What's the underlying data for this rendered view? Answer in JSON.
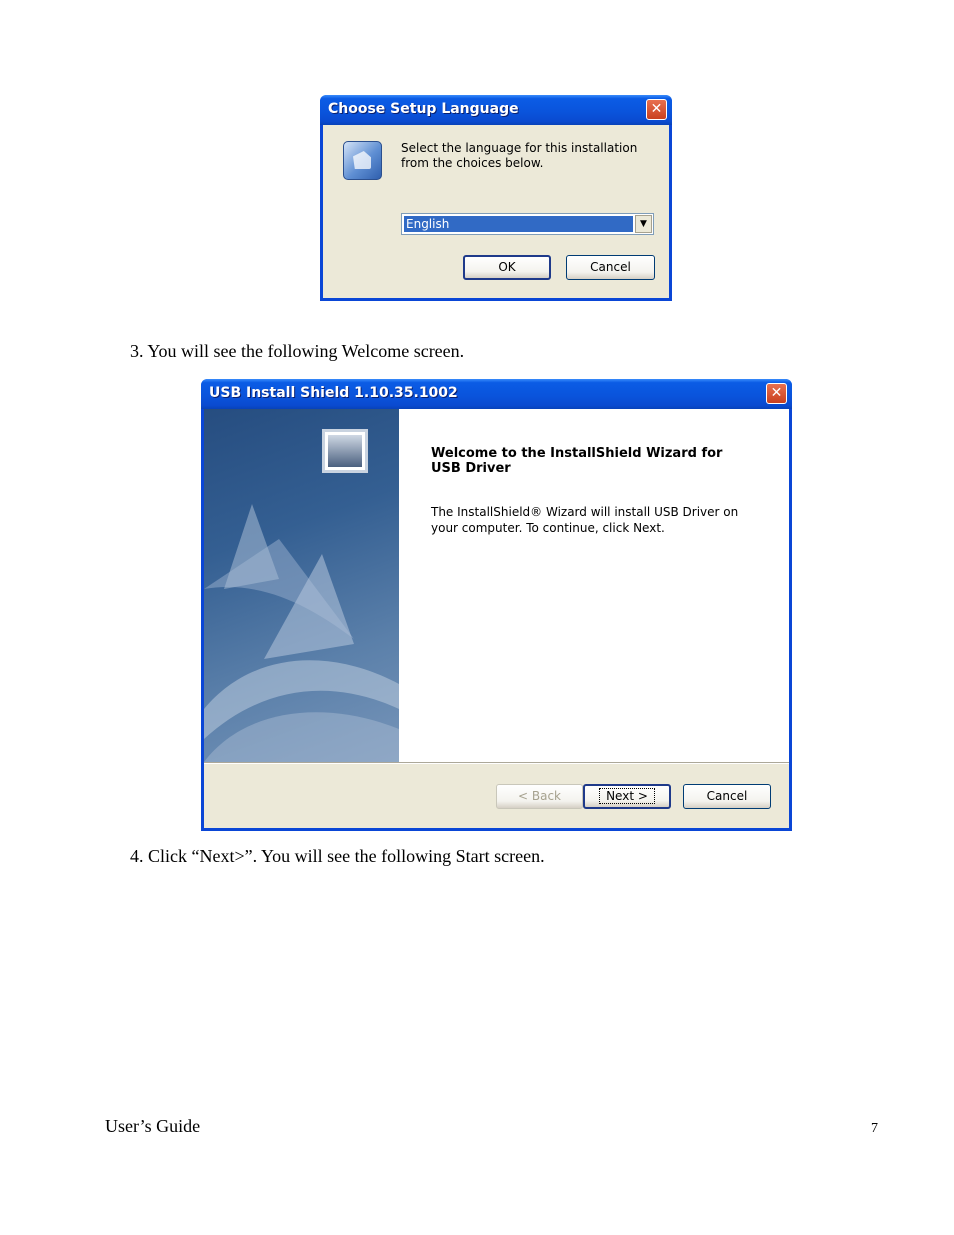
{
  "language_dialog": {
    "title": "Choose Setup Language",
    "close_glyph": "✕",
    "message": "Select the language for this installation from the choices below.",
    "selected_language": "English",
    "dropdown_glyph": "▼",
    "ok_label": "OK",
    "cancel_label": "Cancel"
  },
  "step3_text": "3. You will see the following Welcome screen.",
  "wizard": {
    "title": "USB Install Shield 1.10.35.1002",
    "close_glyph": "✕",
    "heading": "Welcome to the InstallShield Wizard for USB Driver",
    "description": "The InstallShield® Wizard will install USB Driver on your computer.  To continue, click Next.",
    "back_label": "< Back",
    "next_label": "Next >",
    "cancel_label": "Cancel"
  },
  "step4_text": "4. Click “Next>”. You will see the following Start screen.",
  "footer": {
    "guide_title": "User’s Guide",
    "page_number": "7"
  }
}
